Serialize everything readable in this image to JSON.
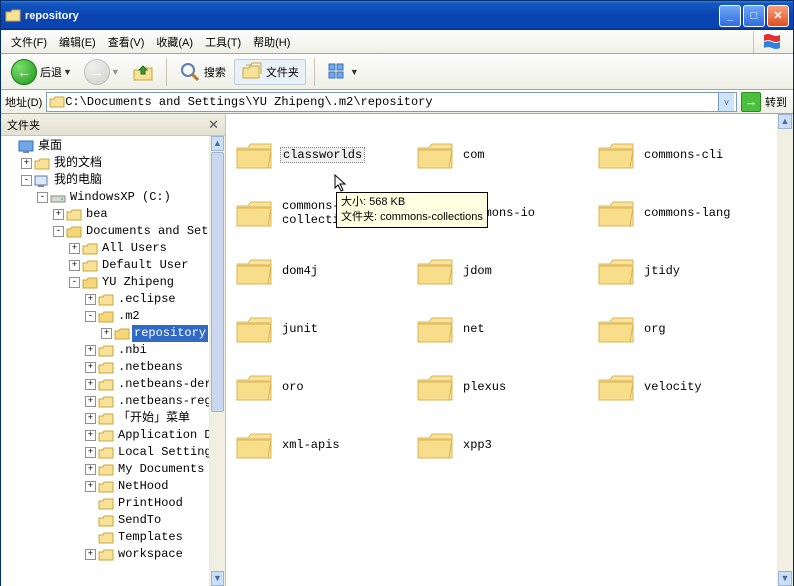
{
  "window": {
    "title": "repository"
  },
  "menu": {
    "file": "文件(F)",
    "edit": "编辑(E)",
    "view": "查看(V)",
    "fav": "收藏(A)",
    "tools": "工具(T)",
    "help": "帮助(H)"
  },
  "toolbar": {
    "back": "后退",
    "search": "搜索",
    "folders": "文件夹"
  },
  "address": {
    "label": "地址(D)",
    "path": "C:\\Documents and Settings\\YU Zhipeng\\.m2\\repository",
    "go": "转到"
  },
  "sidebar": {
    "title": "文件夹",
    "desktop": "桌面",
    "mydocs": "我的文档",
    "mycomp": "我的电脑",
    "drive": "WindowsXP (C:)",
    "nodes": {
      "bea": "bea",
      "ds": "Documents and Settings",
      "allusers": "All Users",
      "defuser": "Default User",
      "yu": "YU Zhipeng",
      "eclipse": ".eclipse",
      "m2": ".m2",
      "repo": "repository",
      "nbi": ".nbi",
      "netbeans": ".netbeans",
      "nbderby": ".netbeans-derby",
      "nbreg": ".netbeans-registration",
      "start": "「开始」菜单",
      "appdata": "Application Data",
      "localset": "Local Settings",
      "mydocs2": "My Documents",
      "nethood": "NetHood",
      "printhood": "PrintHood",
      "sendto": "SendTo",
      "templates": "Templates",
      "workspace": "workspace"
    }
  },
  "folders": [
    "classworlds",
    "com",
    "commons-cli",
    "commons-collections",
    "commons-io",
    "commons-lang",
    "dom4j",
    "jdom",
    "jtidy",
    "junit",
    "net",
    "org",
    "oro",
    "plexus",
    "velocity",
    "xml-apis",
    "xpp3"
  ],
  "tooltip": {
    "line1": "大小: 568 KB",
    "line2": "文件夹: commons-collections"
  }
}
